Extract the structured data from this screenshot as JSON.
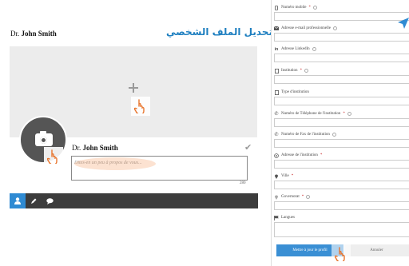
{
  "profile": {
    "title_first": "Dr.",
    "title_name": "John Smith",
    "page_title_ar": "تحديل الملف الشخصي",
    "bio_placeholder": "Dites-en un peu à propos de vous...",
    "bio_counter": "280"
  },
  "icons": {
    "cover_add": "plus-icon",
    "avatar_camera": "camera-icon",
    "cursor": "hand-pointer-icon",
    "verified": "check-icon",
    "tabs": [
      "user-icon",
      "pencil-icon",
      "comment-icon"
    ]
  },
  "form": {
    "fields": [
      {
        "label": "Numéro mobile",
        "required": true,
        "icon": "mobile-icon"
      },
      {
        "label": "Adresse e-mail professionnelle",
        "required": false,
        "icon": "envelope-icon"
      },
      {
        "label": "Adresse LinkedIn",
        "required": false,
        "icon": "linkedin-icon"
      },
      {
        "label": "Institution",
        "required": true,
        "icon": "building-icon"
      },
      {
        "label": "Type d'institution",
        "required": false,
        "icon": "building-icon"
      },
      {
        "label": "Numéro de Téléphone de l'institution",
        "required": true,
        "icon": "phone-icon"
      },
      {
        "label": "Numéro de Fax de l'institution",
        "required": false,
        "icon": "phone-icon"
      },
      {
        "label": "Adresse de l'institution",
        "required": true,
        "icon": "target-icon"
      },
      {
        "label": "Ville",
        "required": true,
        "icon": "map-marker-icon"
      },
      {
        "label": "Governorat",
        "required": true,
        "icon": "map-marker-icon"
      },
      {
        "label": "Langues",
        "required": false,
        "icon": "flag-icon"
      }
    ],
    "save_label": "Mettre à jour le profil",
    "cancel_label": "Annuler"
  },
  "colors": {
    "accent": "#2f8bd3",
    "title_blue": "#1e7fc0",
    "tabbar": "#3c3c3c",
    "cover": "#ececec",
    "avatar_bg": "#555555",
    "highlight": "#f5965a"
  }
}
